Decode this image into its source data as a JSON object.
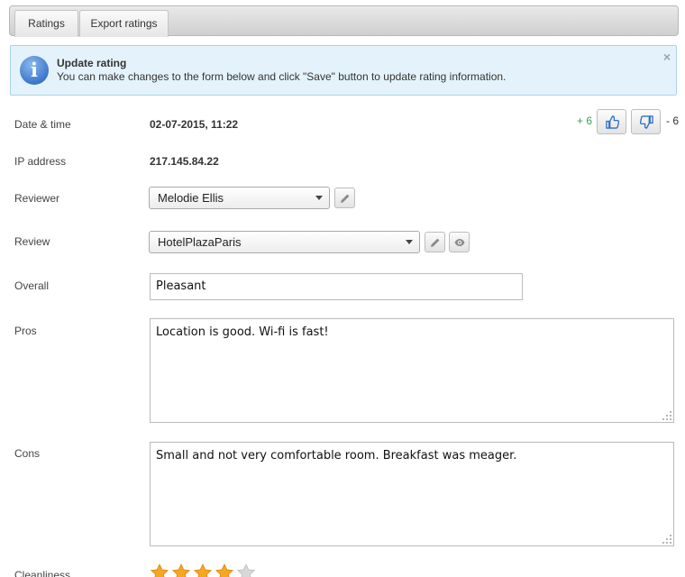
{
  "tabs": [
    {
      "label": "Ratings"
    },
    {
      "label": "Export ratings"
    }
  ],
  "notice": {
    "title": "Update rating",
    "text": "You can make changes to the form below and click \"Save\" button to update rating information.",
    "close_glyph": "×"
  },
  "votes": {
    "up_count": "+ 6",
    "down_count": "- 6"
  },
  "fields": {
    "datetime": {
      "label": "Date & time",
      "value": "02-07-2015, 11:22"
    },
    "ip": {
      "label": "IP address",
      "value": "217.145.84.22"
    },
    "reviewer": {
      "label": "Reviewer",
      "selected": "Melodie Ellis"
    },
    "review": {
      "label": "Review",
      "selected": "HotelPlazaParis"
    },
    "overall": {
      "label": "Overall",
      "value": "Pleasant"
    },
    "pros": {
      "label": "Pros",
      "value": "Location is good. Wi-fi is fast!"
    },
    "cons": {
      "label": "Cons",
      "value": "Small and not very comfortable room. Breakfast was meager."
    },
    "cleanliness": {
      "label": "Cleanliness",
      "rating": 4,
      "max": 5
    }
  },
  "colors": {
    "accent_blue": "#3d78cd",
    "notice_bg": "#e4f3fb",
    "star_filled": "#f5a623",
    "star_empty": "#d8d8d8",
    "vote_positive": "#3aa05a"
  },
  "icons": [
    "info-icon",
    "close-icon",
    "thumbs-up-icon",
    "thumbs-down-icon",
    "pencil-icon",
    "eye-icon",
    "chevron-down-icon",
    "resize-grip-icon",
    "star-icon"
  ]
}
